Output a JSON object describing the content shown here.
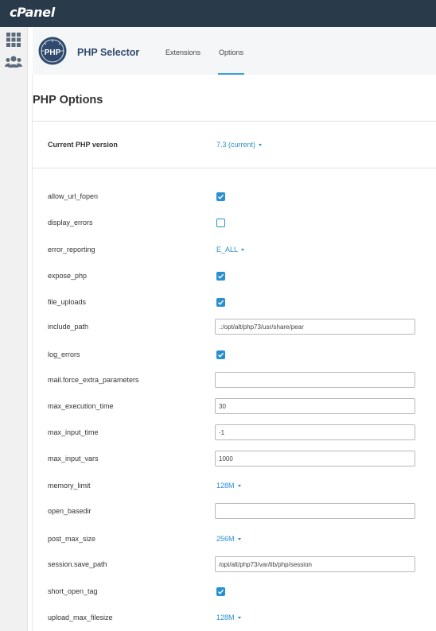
{
  "app": {
    "logo_text": "cPanel"
  },
  "sidebar": {
    "items": [
      {
        "icon": "grid-icon"
      },
      {
        "icon": "users-icon"
      }
    ]
  },
  "header": {
    "php_logo_text": "PHP",
    "title": "PHP Selector",
    "tabs": [
      {
        "label": "Extensions",
        "active": false
      },
      {
        "label": "Options",
        "active": true
      }
    ]
  },
  "main": {
    "title": "PHP Options",
    "version_label": "Current PHP version",
    "version_value": "7.3 (current)",
    "options": [
      {
        "name": "allow_url_fopen",
        "type": "checkbox",
        "checked": true
      },
      {
        "name": "display_errors",
        "type": "checkbox",
        "checked": false
      },
      {
        "name": "error_reporting",
        "type": "select",
        "value": "E_ALL"
      },
      {
        "name": "expose_php",
        "type": "checkbox",
        "checked": true
      },
      {
        "name": "file_uploads",
        "type": "checkbox",
        "checked": true
      },
      {
        "name": "include_path",
        "type": "text",
        "value": ".:/opt/alt/php73/usr/share/pear"
      },
      {
        "name": "log_errors",
        "type": "checkbox",
        "checked": true
      },
      {
        "name": "mail.force_extra_parameters",
        "type": "text",
        "value": ""
      },
      {
        "name": "max_execution_time",
        "type": "text",
        "value": "30"
      },
      {
        "name": "max_input_time",
        "type": "text",
        "value": "-1"
      },
      {
        "name": "max_input_vars",
        "type": "text",
        "value": "1000"
      },
      {
        "name": "memory_limit",
        "type": "select",
        "value": "128M"
      },
      {
        "name": "open_basedir",
        "type": "text",
        "value": ""
      },
      {
        "name": "post_max_size",
        "type": "select",
        "value": "256M"
      },
      {
        "name": "session.save_path",
        "type": "text",
        "value": "/opt/alt/php73/var/lib/php/session"
      },
      {
        "name": "short_open_tag",
        "type": "checkbox",
        "checked": true
      },
      {
        "name": "upload_max_filesize",
        "type": "select",
        "value": "128M"
      }
    ]
  },
  "colors": {
    "topbar": "#293a4a",
    "accent": "#2a8fd0",
    "title": "#2f4a6d"
  }
}
